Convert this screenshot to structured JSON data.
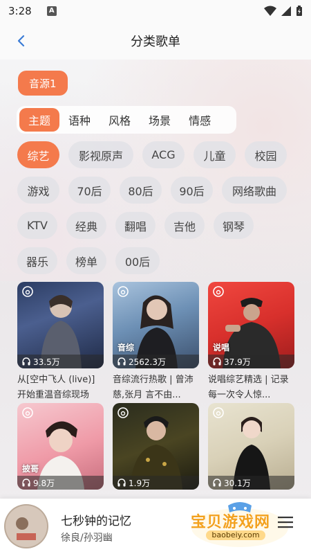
{
  "status_bar": {
    "time": "3:28",
    "notification_letter": "A"
  },
  "header": {
    "title": "分类歌单"
  },
  "source_tab": {
    "label": "音源1"
  },
  "category_tabs": [
    {
      "label": "主题",
      "active": true
    },
    {
      "label": "语种",
      "active": false
    },
    {
      "label": "风格",
      "active": false
    },
    {
      "label": "场景",
      "active": false
    },
    {
      "label": "情感",
      "active": false
    }
  ],
  "tags": [
    [
      "综艺",
      "影视原声",
      "ACG",
      "儿童",
      "校园"
    ],
    [
      "游戏",
      "70后",
      "80后",
      "90后",
      "网络歌曲"
    ],
    [
      "KTV",
      "经典",
      "翻唱",
      "吉他",
      "钢琴"
    ],
    [
      "器乐",
      "榜单",
      "00后"
    ]
  ],
  "playlists": [
    {
      "plays": "33.5万",
      "tag": "",
      "title": "从[空中飞人 (live)] 开始重温音综现场"
    },
    {
      "plays": "2562.3万",
      "tag": "音综",
      "title": "音综流行热歌 | 曾沛慈,张月 言不由..."
    },
    {
      "plays": "37.9万",
      "tag": "说唱",
      "title": "说唱综艺精选 | 记录每一次令人惊..."
    },
    {
      "plays": "9.8万",
      "tag": "披哥",
      "title": ""
    },
    {
      "plays": "1.9万",
      "tag": "",
      "title": ""
    },
    {
      "plays": "30.1万",
      "tag": "",
      "title": ""
    }
  ],
  "player": {
    "title": "七秒钟的记忆",
    "artist": "徐良/孙羽幽"
  },
  "watermark": {
    "text": "宝贝游戏网",
    "url": "baobeiy.com"
  },
  "colors": {
    "accent": "#f47a4c",
    "tag_bg": "#e2e2e6",
    "watermark": "#f3a11e"
  }
}
